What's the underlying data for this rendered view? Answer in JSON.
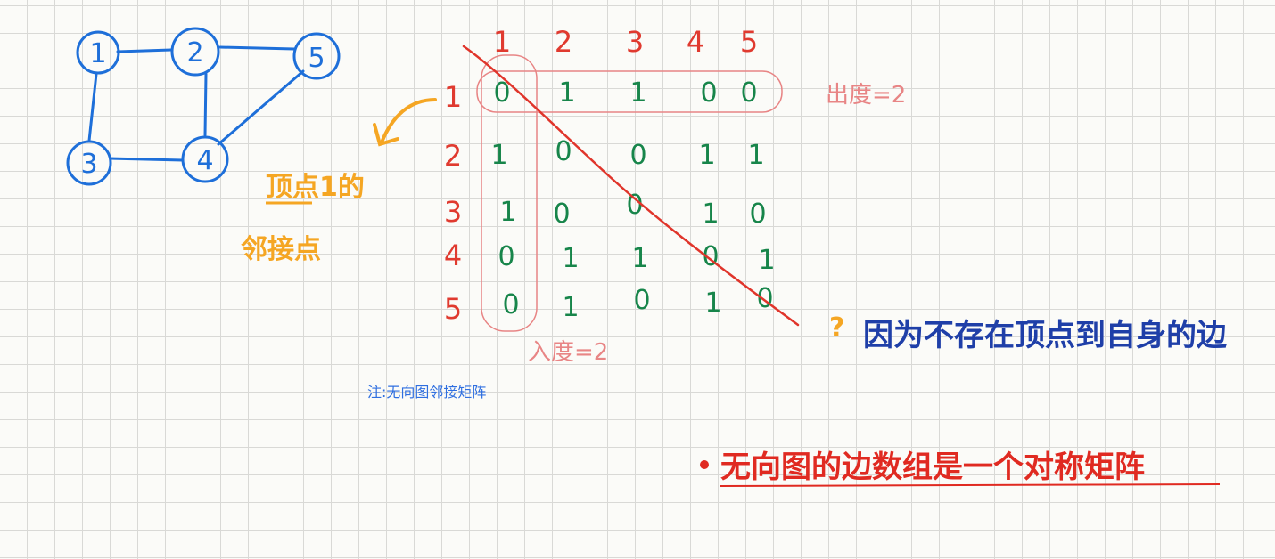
{
  "graph": {
    "nodes": [
      "1",
      "2",
      "3",
      "4",
      "5"
    ],
    "edges": [
      [
        "1",
        "2"
      ],
      [
        "2",
        "5"
      ],
      [
        "1",
        "3"
      ],
      [
        "2",
        "4"
      ],
      [
        "5",
        "4"
      ],
      [
        "3",
        "4"
      ]
    ]
  },
  "matrix": {
    "col_headers": [
      "1",
      "2",
      "3",
      "4",
      "5"
    ],
    "row_headers": [
      "1",
      "2",
      "3",
      "4",
      "5"
    ],
    "rows": [
      [
        "0",
        "1",
        "1",
        "0",
        "0"
      ],
      [
        "1",
        "0",
        "0",
        "1",
        "1"
      ],
      [
        "1",
        "0",
        "0",
        "1",
        "0"
      ],
      [
        "0",
        "1",
        "1",
        "0",
        "1"
      ],
      [
        "0",
        "1",
        "0",
        "1",
        "0"
      ]
    ]
  },
  "annotations": {
    "out_degree": "出度=2",
    "in_degree": "入度=2",
    "neighbors_line1": "顶点1的",
    "neighbors_line2": "邻接点",
    "no_self_loop": "因为不存在顶点到自身的边",
    "undirected_note": "注:无向图邻接矩阵",
    "symmetric": "无向图的边数组是一个对称矩阵"
  },
  "colors": {
    "graph": "#1e6fd9",
    "matrix_headers": "#e03a2f",
    "matrix_cells": "#17854a",
    "highlight": "#e88585",
    "arrow": "#f5a623",
    "note_blue": "#1f3fa8"
  }
}
